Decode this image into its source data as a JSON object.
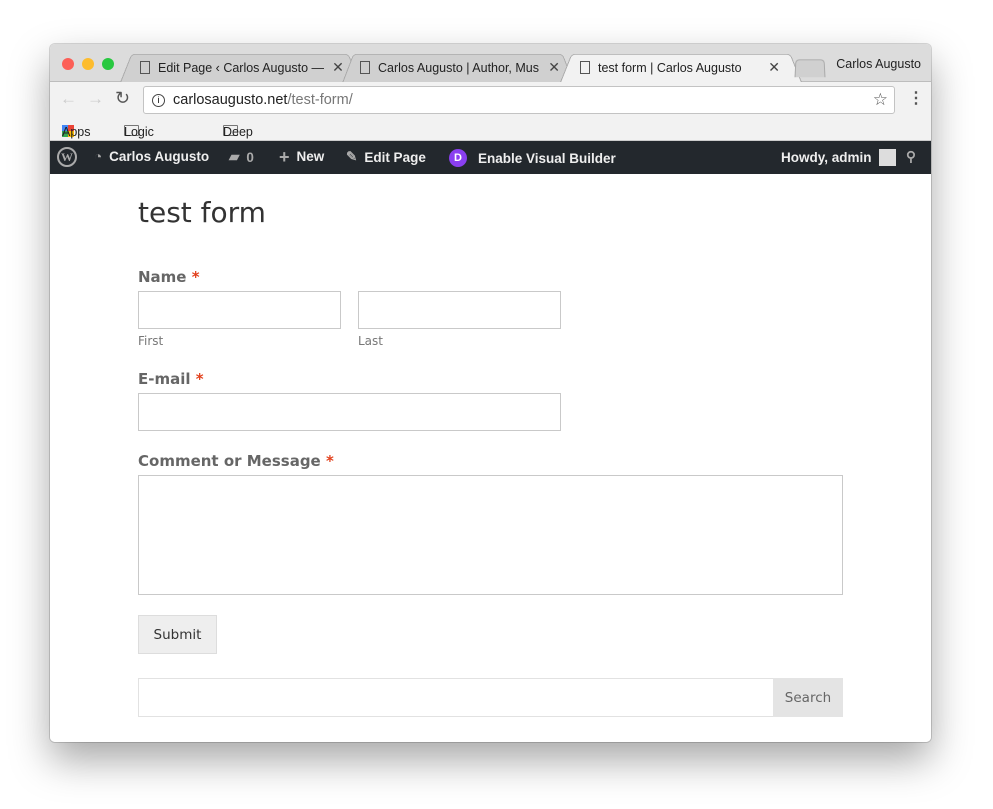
{
  "browser": {
    "tabs": [
      {
        "label": "Edit Page ‹ Carlos Augusto — "
      },
      {
        "label": "Carlos Augusto | Author, Mus"
      },
      {
        "label": "test form | Carlos Augusto",
        "active": true
      }
    ],
    "profile": "Carlos Augusto",
    "url_host": "carlosaugusto.net",
    "url_path": "/test-form/",
    "bookmarks": [
      "Apps",
      "Logic Pro X",
      "Deep House"
    ]
  },
  "admin_bar": {
    "site": "Carlos Augusto",
    "comments": "0",
    "new": "New",
    "edit": "Edit Page",
    "builder": "Enable Visual Builder",
    "builder_icon": "D",
    "howdy": "Howdy, admin"
  },
  "page": {
    "title": "test form",
    "name_label": "Name",
    "first": "First",
    "last": "Last",
    "email_label": "E-mail",
    "message_label": "Comment or Message",
    "required": "*",
    "submit": "Submit",
    "search_button": "Search",
    "search_placeholder": ""
  },
  "colors": {
    "admin_bar": "#23282d",
    "required": "#e2401c",
    "divi": "#8a3ff0"
  }
}
